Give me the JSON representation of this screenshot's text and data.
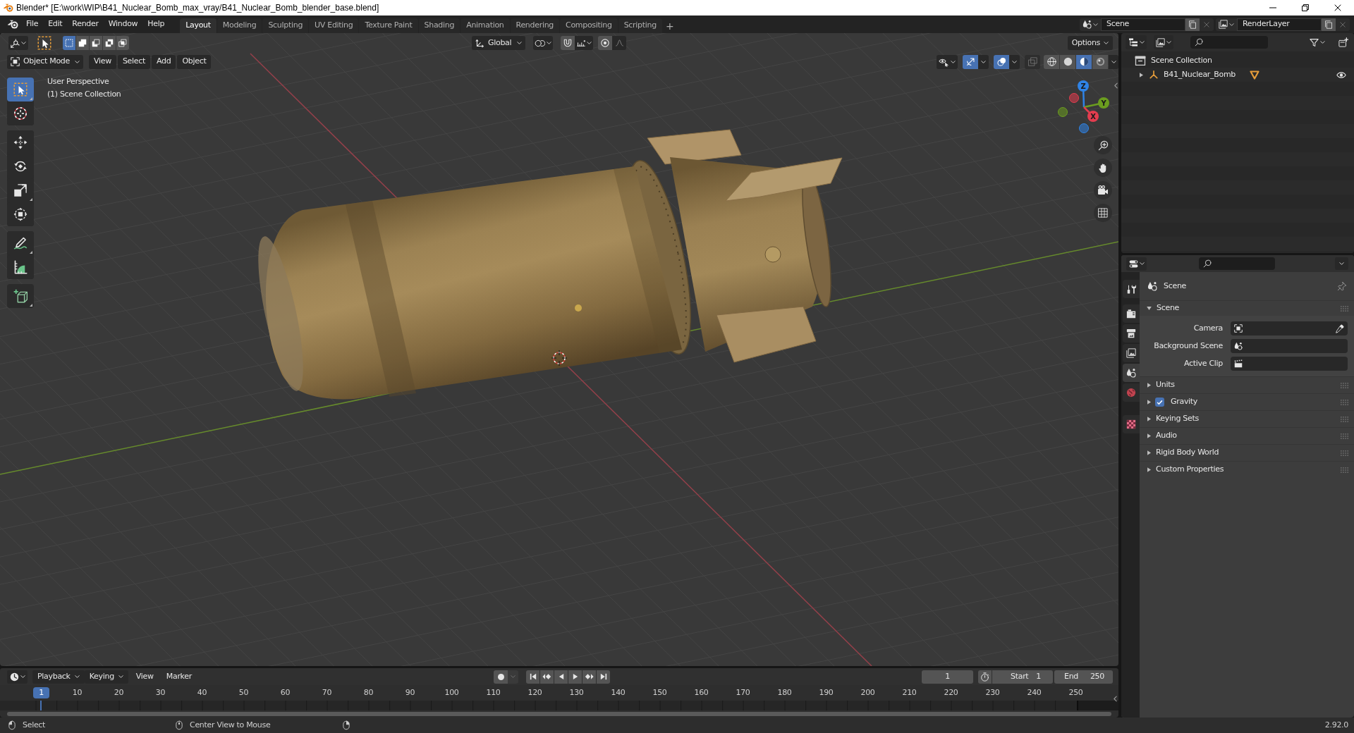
{
  "window": {
    "title": "Blender* [E:\\work\\WIP\\B41_Nuclear_Bomb_max_vray/B41_Nuclear_Bomb_blender_base.blend]"
  },
  "menu": [
    "File",
    "Edit",
    "Render",
    "Window",
    "Help"
  ],
  "workspaces": [
    {
      "label": "Layout",
      "selected": true
    },
    {
      "label": "Modeling",
      "selected": false
    },
    {
      "label": "Sculpting",
      "selected": false
    },
    {
      "label": "UV Editing",
      "selected": false
    },
    {
      "label": "Texture Paint",
      "selected": false
    },
    {
      "label": "Shading",
      "selected": false
    },
    {
      "label": "Animation",
      "selected": false
    },
    {
      "label": "Rendering",
      "selected": false
    },
    {
      "label": "Compositing",
      "selected": false
    },
    {
      "label": "Scripting",
      "selected": false
    }
  ],
  "add_workspace": "+",
  "scene": {
    "value": "Scene"
  },
  "view_layer": {
    "value": "RenderLayer"
  },
  "viewport": {
    "select_modes": [
      {
        "kind": "set",
        "selected": true
      },
      {
        "kind": "extend",
        "selected": false
      },
      {
        "kind": "subtract",
        "selected": false
      },
      {
        "kind": "invert",
        "selected": false
      },
      {
        "kind": "intersect",
        "selected": false
      }
    ],
    "orientation": "Global",
    "options": "Options",
    "mode": "Object Mode",
    "menus": [
      "View",
      "Select",
      "Add",
      "Object"
    ],
    "toggles": [
      {
        "kind": "gizmos",
        "on": true
      },
      {
        "kind": "overlays",
        "on": true
      },
      {
        "kind": "xray",
        "on": false
      }
    ],
    "shading": [
      {
        "kind": "wireframe",
        "selected": false
      },
      {
        "kind": "solid",
        "selected": false
      },
      {
        "kind": "material",
        "selected": true
      },
      {
        "kind": "rendered",
        "selected": false
      }
    ],
    "info": [
      "User Perspective",
      "(1) Scene Collection"
    ],
    "tool_groups": [
      {
        "tools": [
          {
            "kind": "select",
            "selected": true,
            "variants": true
          },
          {
            "kind": "cursor",
            "selected": false,
            "variants": false
          }
        ]
      },
      {
        "tools": [
          {
            "kind": "move",
            "selected": false,
            "variants": false
          },
          {
            "kind": "rotate",
            "selected": false,
            "variants": false
          },
          {
            "kind": "scale",
            "selected": false,
            "variants": true
          },
          {
            "kind": "transform",
            "selected": false,
            "variants": false
          }
        ]
      },
      {
        "tools": [
          {
            "kind": "annotate",
            "selected": false,
            "variants": true
          },
          {
            "kind": "measure",
            "selected": false,
            "variants": false
          }
        ]
      },
      {
        "tools": [
          {
            "kind": "add_cube",
            "selected": false,
            "variants": true
          }
        ]
      }
    ],
    "gizmo_axes": [
      {
        "label": "Z",
        "color": "#2f83e6"
      },
      {
        "label": "Y",
        "color": "#6b9d1f"
      },
      {
        "label": "X",
        "color": "#e33d4f"
      }
    ]
  },
  "outliner": {
    "root": "Scene Collection",
    "items": [
      {
        "label": "B41_Nuclear_Bomb",
        "expanded": false,
        "visible": true
      }
    ]
  },
  "properties": {
    "tab_groups": [
      {
        "tabs": [
          {
            "kind": "tool",
            "selected": false
          }
        ]
      },
      {
        "tabs": [
          {
            "kind": "render",
            "selected": false
          },
          {
            "kind": "output",
            "selected": false
          },
          {
            "kind": "view_layer",
            "selected": false
          },
          {
            "kind": "scene",
            "selected": true
          },
          {
            "kind": "world",
            "selected": false
          }
        ]
      },
      {
        "tabs": [
          {
            "kind": "texture",
            "selected": false
          }
        ]
      }
    ],
    "context": "Scene",
    "panels": [
      {
        "label": "Scene",
        "expanded": true,
        "fields": [
          {
            "kind": "camera",
            "label": "Camera"
          },
          {
            "kind": "scene",
            "label": "Background Scene"
          },
          {
            "kind": "clip",
            "label": "Active Clip"
          }
        ]
      },
      {
        "label": "Units",
        "expanded": false
      },
      {
        "label": "Gravity",
        "expanded": false,
        "checked": true
      },
      {
        "label": "Keying Sets",
        "expanded": false
      },
      {
        "label": "Audio",
        "expanded": false
      },
      {
        "label": "Rigid Body World",
        "expanded": false
      },
      {
        "label": "Custom Properties",
        "expanded": false
      }
    ]
  },
  "timeline": {
    "menus": [
      {
        "kind": "dropdown",
        "label": "Playback"
      },
      {
        "kind": "dropdown",
        "label": "Keying"
      },
      {
        "kind": "menu",
        "label": "View"
      },
      {
        "kind": "menu",
        "label": "Marker"
      }
    ],
    "auto_keying": false,
    "current_frame": "1",
    "start": {
      "label": "Start",
      "value": "1"
    },
    "end": {
      "label": "End",
      "value": "250"
    },
    "playhead": "1",
    "ruler": [
      "10",
      "20",
      "30",
      "40",
      "50",
      "60",
      "70",
      "80",
      "90",
      "100",
      "110",
      "120",
      "130",
      "140",
      "150",
      "160",
      "170",
      "180",
      "190",
      "200",
      "210",
      "220",
      "230",
      "240",
      "250"
    ]
  },
  "status_bar": {
    "hints": [
      {
        "kind": "left",
        "label": "Select"
      },
      {
        "kind": "middle",
        "label": "Center View to Mouse"
      },
      {
        "kind": "right"
      }
    ],
    "version": "2.92.0"
  }
}
